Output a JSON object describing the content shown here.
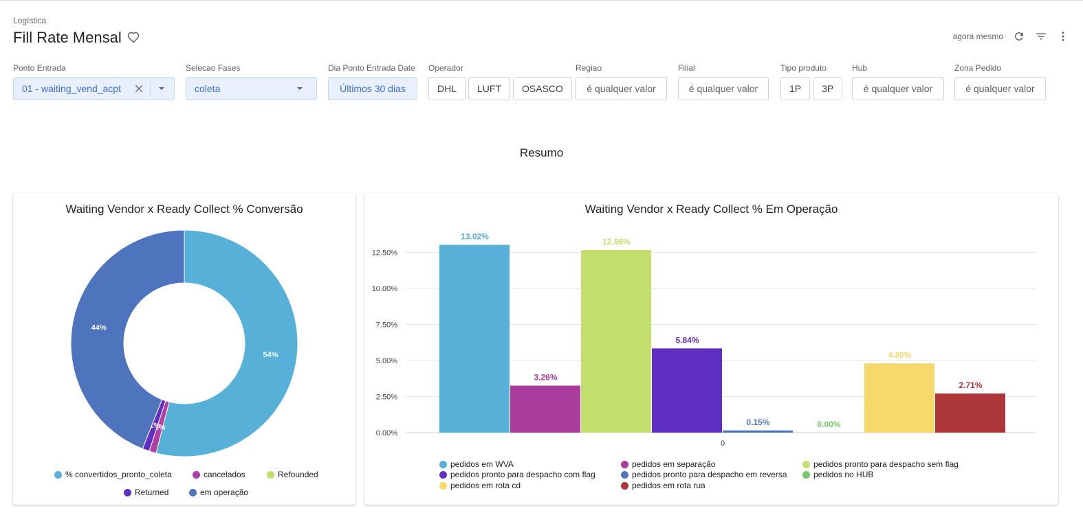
{
  "header": {
    "breadcrumb": "Logística",
    "title": "Fill Rate Mensal",
    "updated": "agora mesmo",
    "icons": [
      "heart-icon",
      "refresh-icon",
      "filter-icon",
      "more-vert-icon"
    ]
  },
  "filters": [
    {
      "label": "Ponto Entrada",
      "value": "01 - waiting_vend_acpt"
    },
    {
      "label": "Selecao Fases",
      "value": "coleta"
    },
    {
      "label": "Dia Ponto Entrada Date",
      "value": "Últimos 30 dias"
    },
    {
      "label": "Operador",
      "chips": [
        "DHL",
        "LUFT",
        "OSASCO"
      ]
    },
    {
      "label": "Regiao",
      "value": "é qualquer valor"
    },
    {
      "label": "Filial",
      "value": "é qualquer valor"
    },
    {
      "label": "Tipo produto",
      "chips": [
        "1P",
        "3P"
      ]
    },
    {
      "label": "Hub",
      "value": "é qualquer valor"
    },
    {
      "label": "Zona Pedido",
      "value": "é qualquer valor"
    }
  ],
  "section_title": "Resumo",
  "chart_data": [
    {
      "type": "pie",
      "title": "Waiting Vendor x Ready Collect % Conversão",
      "categories": [
        "% convertidos_pronto_coleta",
        "cancelados",
        "Refounded",
        "Returned",
        "em operação"
      ],
      "values": [
        54,
        1,
        0,
        1,
        44
      ],
      "labels": [
        "54%",
        "1%",
        "",
        "1%",
        "44%"
      ],
      "colors": [
        "#56b0d8",
        "#b03da5",
        "#c2df6d",
        "#5f2fc2",
        "#4e74bd"
      ],
      "legend": "bottom"
    },
    {
      "type": "bar",
      "title": "Waiting Vendor x Ready Collect % Em Operação",
      "categories": [
        "0"
      ],
      "series": [
        {
          "name": "pedidos em WVA",
          "values": [
            13.02
          ],
          "label": "13.02%",
          "color": "#56b0d8"
        },
        {
          "name": "pedidos em separação",
          "values": [
            3.26
          ],
          "label": "3.26%",
          "color": "#ab3c9e"
        },
        {
          "name": "pedidos pronto para despacho sem flag",
          "values": [
            12.66
          ],
          "label": "12.66%",
          "color": "#c2df6d"
        },
        {
          "name": "pedidos pronto para despacho com flag",
          "values": [
            5.84
          ],
          "label": "5.84%",
          "color": "#5f2fc2"
        },
        {
          "name": "pedidos pronto para despacho em reversa",
          "values": [
            0.15
          ],
          "label": "0.15%",
          "color": "#4e74bd"
        },
        {
          "name": "pedidos no HUB",
          "values": [
            0.0
          ],
          "label": "0.00%",
          "color": "#77c96b"
        },
        {
          "name": "pedidos em rota cd",
          "values": [
            4.8
          ],
          "label": "4.80%",
          "color": "#f7d96a"
        },
        {
          "name": "pedidos em rota rua",
          "values": [
            2.71
          ],
          "label": "2.71%",
          "color": "#ad363a"
        }
      ],
      "yticks": [
        "0.00%",
        "2.50%",
        "5.00%",
        "7.50%",
        "10.00%",
        "12.50%"
      ],
      "ylim": [
        0,
        14
      ],
      "grid": true,
      "legend": "bottom"
    }
  ]
}
